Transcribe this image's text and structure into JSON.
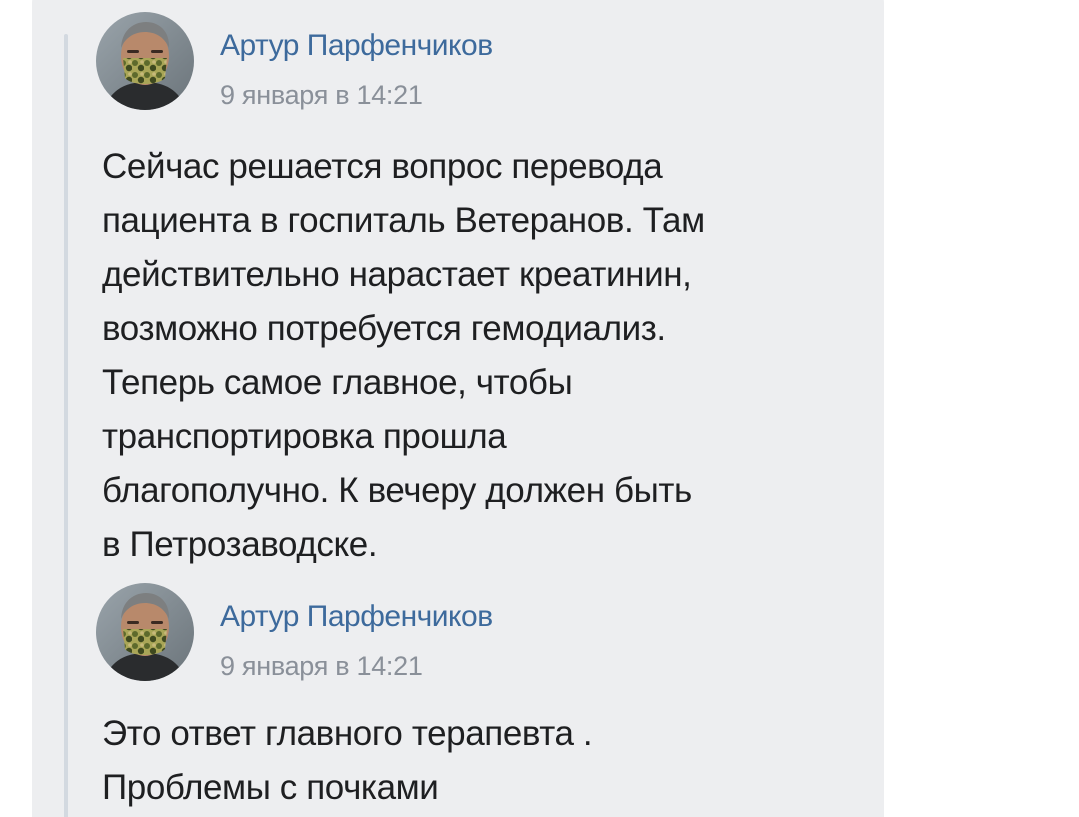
{
  "colors": {
    "bubble_bg": "#edeef0",
    "author_link": "#3d6a9c",
    "date_text": "#8a9099",
    "body_text": "#1e1f21",
    "quote_bar": "#d3d9e0"
  },
  "posts": [
    {
      "author": "Артур Парфенчиков",
      "date": "9 января в 14:21",
      "avatar_icon": "user-avatar-masked-man",
      "lines": [
        "Сейчас решается вопрос перевода",
        "пациента в госпиталь Ветеранов. Там",
        "действительно нарастает креатинин,",
        "возможно потребуется гемодиализ.",
        "Теперь самое главное, чтобы",
        "транспортировка прошла",
        "благополучно. К вечеру должен быть",
        "в Петрозаводске."
      ]
    },
    {
      "author": "Артур Парфенчиков",
      "date": "9 января в 14:21",
      "avatar_icon": "user-avatar-masked-man",
      "lines": [
        "Это ответ главного терапевта .",
        "Проблемы с почками"
      ]
    }
  ]
}
